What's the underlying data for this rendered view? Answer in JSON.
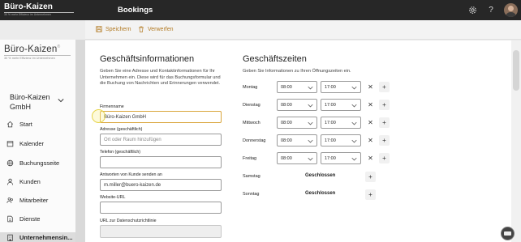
{
  "topbar": {
    "brand": "Büro-Kaizen",
    "brand_tag": "30 % mehr Effizienz im Unternehmen",
    "app_title": "Bookings",
    "settings_icon": "gear-icon",
    "help_icon": "question-icon"
  },
  "toolbar": {
    "save_label": "Speichern",
    "discard_label": "Verwerfen"
  },
  "sidebar": {
    "logo_name": "Büro-Kaizen",
    "logo_reg": "®",
    "logo_tag": "30 % mehr Effizienz im Unternehmen",
    "company": "Büro-Kaizen GmbH",
    "items": [
      {
        "label": "Start",
        "icon": "home-icon"
      },
      {
        "label": "Kalender",
        "icon": "calendar-icon"
      },
      {
        "label": "Buchungsseite",
        "icon": "globe-icon"
      },
      {
        "label": "Kunden",
        "icon": "person-icon"
      },
      {
        "label": "Mitarbeiter",
        "icon": "people-icon"
      },
      {
        "label": "Dienste",
        "icon": "services-icon"
      },
      {
        "label": "Unternehmensin...",
        "icon": "building-icon"
      }
    ]
  },
  "business_info": {
    "title": "Geschäftsinformationen",
    "description": "Geben Sie eine Adresse und Kontaktinformationen für Ihr Unternehmen ein. Diese wird für das Buchungsformular und die Buchung von Nachrichten und Erinnerungen verwendet.",
    "fields": {
      "company_label": "Firmenname",
      "company_value": "Büro-Kaizen GmbH",
      "address_label": "Adresse (geschäftlich)",
      "address_placeholder": "Ort oder Raum hinzufügen",
      "phone_label": "Telefon (geschäftlich)",
      "phone_value": "",
      "reply_label": "Antworten von Kunde senden an",
      "reply_value": "m.miller@buero-kaizen.de",
      "website_label": "Website-URL",
      "website_value": "",
      "privacy_label": "URL zur Datenschutzrichtlinie",
      "privacy_value": ""
    }
  },
  "business_hours": {
    "title": "Geschäftszeiten",
    "description": "Geben Sie Informationen zu Ihren Öffnungszeiten ein.",
    "days": [
      {
        "day": "Montag",
        "from": "08:00",
        "to": "17:00"
      },
      {
        "day": "Dienstag",
        "from": "08:00",
        "to": "17:00"
      },
      {
        "day": "Mittwoch",
        "from": "08:00",
        "to": "17:00"
      },
      {
        "day": "Donnerstag",
        "from": "08:00",
        "to": "17:00"
      },
      {
        "day": "Freitag",
        "from": "08:00",
        "to": "17:00"
      },
      {
        "day": "Samstag",
        "status": "Geschlossen"
      },
      {
        "day": "Sonntag",
        "status": "Geschlossen"
      }
    ]
  }
}
